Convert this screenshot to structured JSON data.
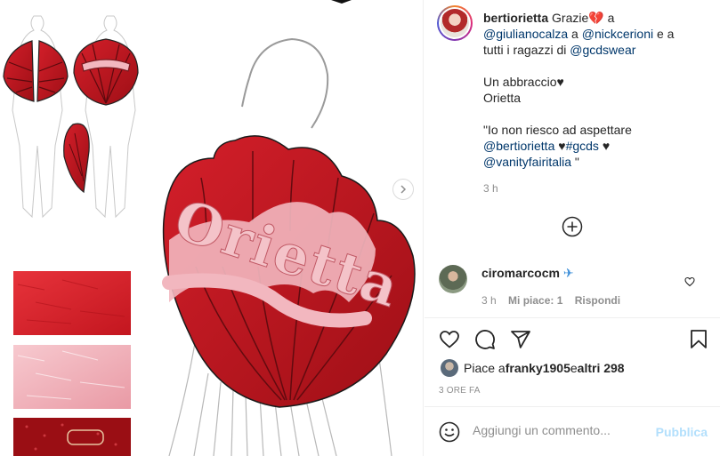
{
  "post": {
    "username": "bertiorietta",
    "caption_line1_rest": " Grazie",
    "caption_line1_after": " a",
    "mention_1": "@giulianocalza",
    "caption_a": " a ",
    "mention_2": "@nickcerioni",
    "caption_e_a": " e a",
    "caption_tutti": "tutti i ragazzi di ",
    "mention_3": "@gcdswear",
    "caption_abbraccio": "Un abbraccio",
    "caption_signature": "Orietta",
    "quote_open": "\"Io non riesco ad aspettare",
    "mention_4": "@bertiorietta",
    "hashtag": "#gcds",
    "mention_5": "@vanityfairitalia",
    "quote_close": " \"",
    "time": "3 h"
  },
  "comment": {
    "username": "ciromarcocm",
    "time": "3 h",
    "likes": "Mi piace: 1",
    "reply": "Rispondi"
  },
  "likes": {
    "prefix": "Piace a ",
    "user": "franky1905",
    "middle": " e ",
    "others": "altri 298"
  },
  "date": "3 ORE FA",
  "add_comment": {
    "placeholder": "Aggiungi un commento...",
    "publish": "Pubblica"
  },
  "media": {
    "dress_lettering": "Orietta"
  },
  "icons": {
    "heart": "heart-icon",
    "comment": "comment-icon",
    "share": "share-icon",
    "save": "bookmark-icon",
    "emoji": "emoji-icon",
    "load_more": "plus-circle-icon",
    "next": "chevron-right-icon"
  },
  "colors": {
    "link": "#00376b",
    "muted": "#8e8e8e",
    "publish_disabled": "#b2dffc",
    "dress_red": "#b3121b"
  }
}
